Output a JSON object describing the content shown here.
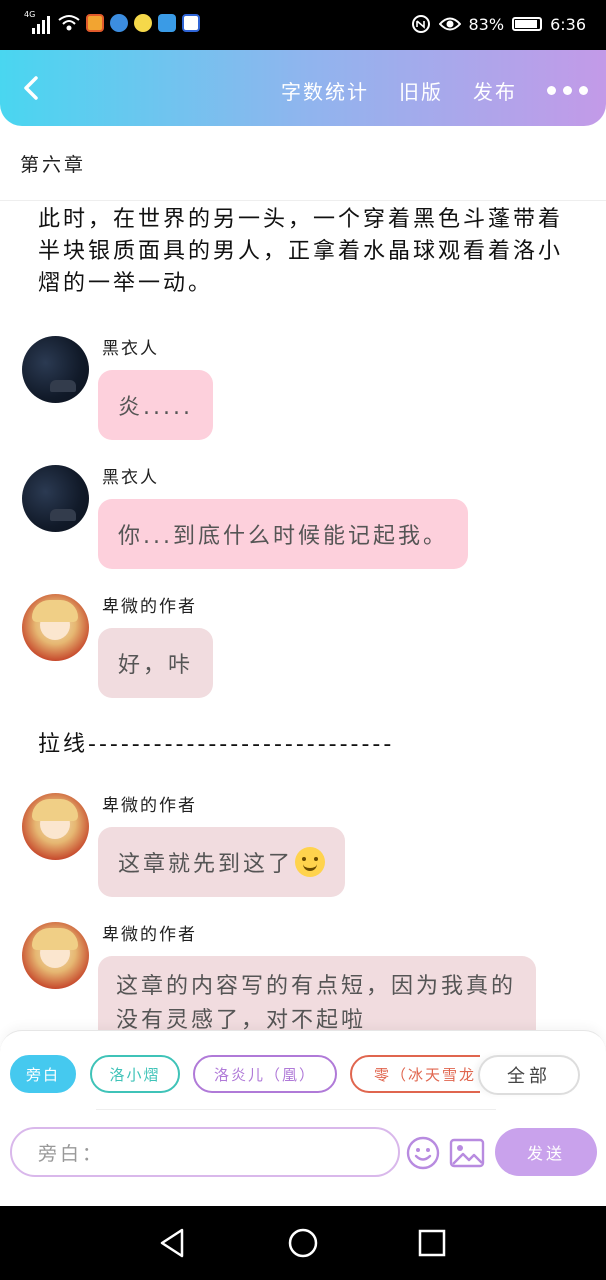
{
  "status_bar": {
    "network": "4G",
    "battery": "83%",
    "time": "6:36"
  },
  "header": {
    "word_count": "字数统计",
    "old_version": "旧版",
    "publish": "发布"
  },
  "chapter_title": "第六章",
  "narration": "此时，在世界的另一头，一个穿着黑色斗蓬带着半块银质面具的男人，正拿着水晶球观看着洛小熠的一举一动。",
  "messages": [
    {
      "name": "黑衣人",
      "text": "炎....."
    },
    {
      "name": "黑衣人",
      "text": "你...到底什么时候能记起我。"
    },
    {
      "name": "卑微的作者",
      "text": "好，咔"
    },
    {
      "name": "卑微的作者",
      "text": "这章就先到这了"
    },
    {
      "name": "卑微的作者",
      "text": "这章的内容写的有点短，因为我真的没有灵感了，对不起啦"
    }
  ],
  "pull_line": "拉线----------------------------",
  "roles": [
    {
      "label": "旁白",
      "color": "#45c9ef",
      "filled": true
    },
    {
      "label": "洛小熠",
      "color": "#3fc3b8",
      "filled": false
    },
    {
      "label": "洛炎儿（凰）",
      "color": "#b07ad8",
      "filled": false
    },
    {
      "label": "零（冰天雪龙",
      "color": "#e0664f",
      "filled": false
    }
  ],
  "all_label": "全部",
  "input_placeholder": "旁白：",
  "send_label": "发送"
}
